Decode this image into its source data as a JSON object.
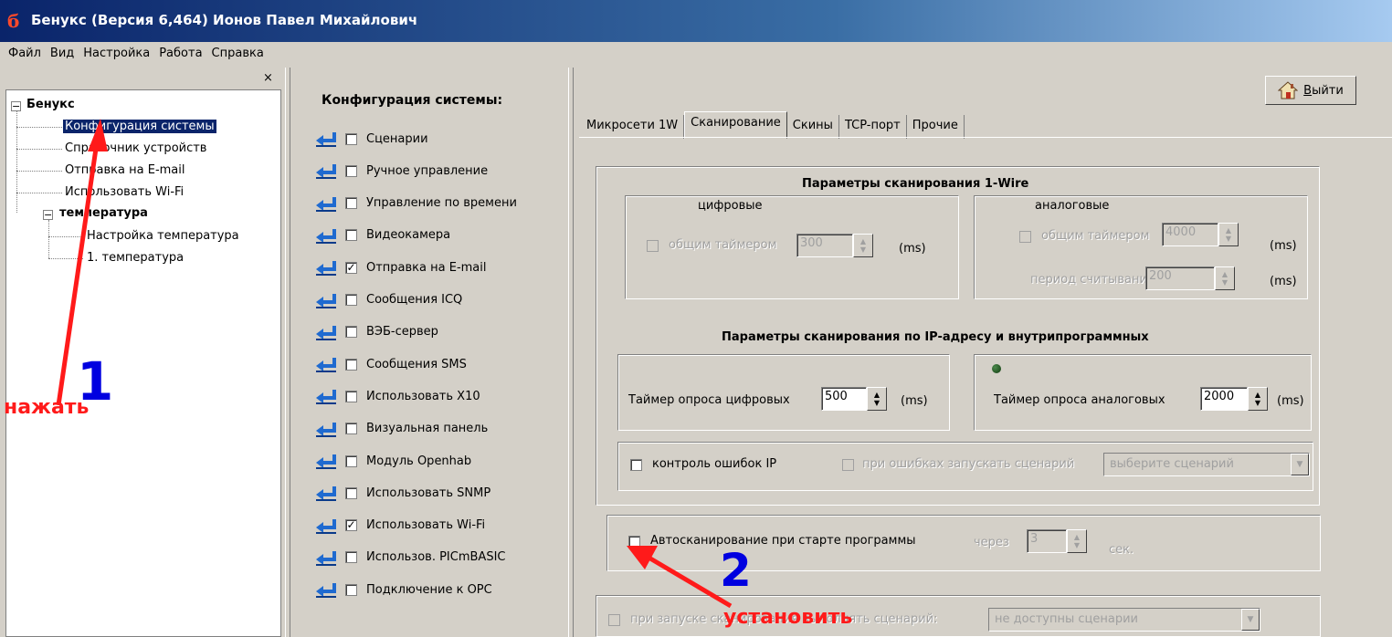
{
  "window": {
    "title": "Бенукс (Версия 6,464) Ионов Павел Михайлович",
    "app_icon": "б"
  },
  "menu": [
    "Файл",
    "Вид",
    "Настройка",
    "Работа",
    "Справка"
  ],
  "tree": {
    "close_glyph": "×",
    "root": {
      "label": "Бенукс",
      "expander": "−"
    },
    "items": [
      "Конфигурация системы",
      "Справочник устройств",
      "Отправка на E-mail",
      "Использовать Wi-Fi"
    ],
    "group": {
      "label": "температура",
      "expander": "−"
    },
    "group_items": [
      "Настройка температура",
      "1. температура"
    ]
  },
  "config": {
    "title": "Конфигурация системы:",
    "items": [
      {
        "label": "Сценарии",
        "checked": false
      },
      {
        "label": "Ручное управление",
        "checked": false
      },
      {
        "label": "Управление по времени",
        "checked": false
      },
      {
        "label": "Видеокамера",
        "checked": false
      },
      {
        "label": "Отправка на E-mail",
        "checked": true
      },
      {
        "label": "Сообщения ICQ",
        "checked": false
      },
      {
        "label": "ВЭБ-сервер",
        "checked": false
      },
      {
        "label": "Сообщения SMS",
        "checked": false
      },
      {
        "label": "Использовать X10",
        "checked": false
      },
      {
        "label": "Визуальная панель",
        "checked": false
      },
      {
        "label": "Модуль Openhab",
        "checked": false
      },
      {
        "label": "Использовать SNMP",
        "checked": false
      },
      {
        "label": "Использовать Wi-Fi",
        "checked": true
      },
      {
        "label": "Использов. PICmBASIC",
        "checked": false
      },
      {
        "label": "Подключение к OPC",
        "checked": false
      }
    ]
  },
  "exit_button": {
    "underlined": "В",
    "rest": "ыйти"
  },
  "tabs": [
    "Микросети 1W",
    "Сканирование",
    "Скины",
    "TCP-порт",
    "Прочие"
  ],
  "active_tab": 1,
  "scan_1wire": {
    "title": "Параметры сканирования 1-Wire",
    "digital": {
      "heading": "цифровые",
      "timer_label": "общим таймером",
      "timer_value": "300",
      "unit": "(ms)"
    },
    "analog": {
      "heading": "аналоговые",
      "timer_label": "общим таймером",
      "timer_value": "4000",
      "unit": "(ms)",
      "period_label": "период считывания:",
      "period_value": "200",
      "period_unit": "(ms)"
    }
  },
  "scan_ip": {
    "title": "Параметры сканирования по IP-адресу и внутрипрограммных",
    "digital_label": "Таймер опроса цифровых",
    "digital_value": "500",
    "digital_unit": "(ms)",
    "analog_label": "Таймер опроса аналоговых",
    "analog_value": "2000",
    "analog_unit": "(ms)",
    "error_control_label": "контроль ошибок IP",
    "on_error_label": "при ошибках запускать сценарий",
    "on_error_combo": "выберите сценарий"
  },
  "autoscan": {
    "label": "Автосканирование при старте программы",
    "after_label": "через",
    "value": "3",
    "unit": "сек."
  },
  "startup": {
    "label": "при запуске сканирования выполнять сценарий:",
    "combo": "не доступны сценарии"
  },
  "annotations": {
    "press": "нажать",
    "step1": "1",
    "step2": "2",
    "set": "установить"
  },
  "colors": {
    "selection": "#0a246a",
    "annotation_red": "#ff1a1a",
    "annotation_blue": "#0000e0"
  }
}
